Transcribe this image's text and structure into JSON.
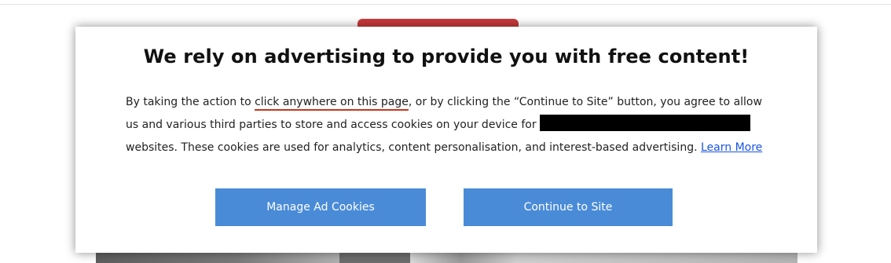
{
  "dialog": {
    "title": "We rely on advertising to provide you with free content!",
    "body": {
      "part1": "By taking the action to ",
      "highlighted": "click anywhere on this page",
      "part2": ", or by clicking the “Continue to Site” button, you agree to allow us and various third parties to store and access cookies on your device for ",
      "part3": " websites. These cookies are used for analytics, content personalisation, and interest-based advertising. ",
      "learn_more": "Learn More"
    },
    "buttons": {
      "manage": "Manage Ad Cookies",
      "continue": "Continue to Site"
    }
  },
  "colors": {
    "button_bg": "#4a8bd8",
    "link": "#1a55e0",
    "underline_accent": "#c8351f",
    "background_logo": "#c9393a"
  }
}
